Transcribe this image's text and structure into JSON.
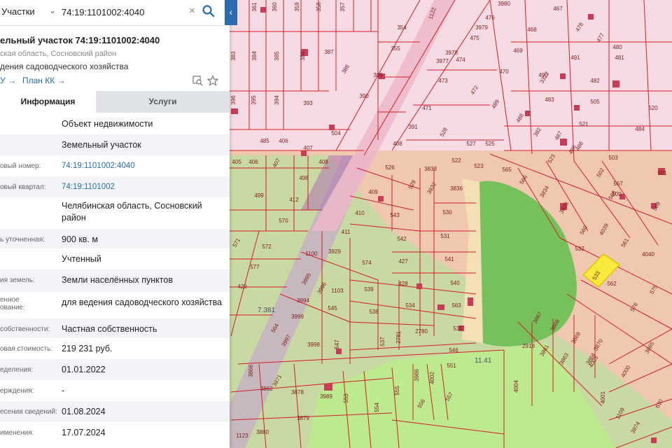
{
  "search": {
    "type_label": "Участки",
    "query": "74:19:1101002:4040"
  },
  "parcel": {
    "title": "ельный участок 74:19:1101002:4040",
    "address_short": "ская область, Сосновский район",
    "purpose_short": "дения садоводческого хозяйства",
    "link_egrn": "У →",
    "link_plan": "План КК →"
  },
  "tabs": {
    "info": "Информация",
    "services": "Услуги"
  },
  "info_rows": [
    {
      "label": "",
      "value": "Объект недвижимости"
    },
    {
      "label": "",
      "value": "Земельный участок"
    },
    {
      "label": "овый номер:",
      "value": "74:19:1101002:4040"
    },
    {
      "label": "овый квартал:",
      "value": "74:19:1101002"
    },
    {
      "label": "",
      "value": "Челябинская область, Сосновский район"
    },
    {
      "label": "ь уточненная:",
      "value": "900 кв. м"
    },
    {
      "label": "",
      "value": "Учтенный"
    },
    {
      "label": "ия земель:",
      "value": "Земли населённых пунктов"
    },
    {
      "label": "енное\nование:",
      "value": "для ведения садоводческого хозяйства"
    },
    {
      "label": "собственности:",
      "value": "Частная собственность"
    },
    {
      "label": "овая стоимость:",
      "value": "219 231 руб."
    },
    {
      "label": "еделения:",
      "value": "01.01.2022"
    },
    {
      "label": "ерждения:",
      "value": "-"
    },
    {
      "label": "есения сведений:",
      "value": "01.08.2024"
    },
    {
      "label": "именения:",
      "value": "17.07.2024"
    }
  ],
  "map": {
    "colors": {
      "boundary": "#d21f26",
      "pink_zone": "#f6dbe4",
      "orange_zone": "#f0c8b0",
      "green_zone": "#c9d9a3",
      "forest": "#77c15c",
      "meadow": "#bdea8f",
      "selected": "#f7ea3c"
    },
    "zone_labels": [
      "7.381",
      "11.41"
    ],
    "parcel_labels": [
      "361",
      "360",
      "359",
      "358",
      "357",
      "1122",
      "3980",
      "476",
      "467",
      "354",
      "3979",
      "468",
      "478",
      "477",
      "383",
      "384",
      "385",
      "386",
      "387",
      "355",
      "3978",
      "475",
      "469",
      "480",
      "3977",
      "474",
      "3322",
      "491",
      "481",
      "388",
      "389",
      "473",
      "470",
      "490",
      "482",
      "396",
      "395",
      "394",
      "393",
      "390",
      "472",
      "489",
      "483",
      "505",
      "520",
      "471",
      "488",
      "391",
      "528",
      "521",
      "484",
      "504",
      "392",
      "487",
      "486",
      "485",
      "406",
      "407",
      "408",
      "527",
      "525",
      "523",
      "486",
      "503",
      "405",
      "406",
      "407",
      "408",
      "526",
      "3833",
      "522",
      "523",
      "565",
      "566",
      "502",
      "501",
      "498",
      "409",
      "529",
      "3832",
      "3836",
      "3834",
      "567",
      "500",
      "499",
      "412",
      "410",
      "543",
      "530",
      "3835",
      "568",
      "569",
      "570",
      "411",
      "542",
      "531",
      "560",
      "4039",
      "571",
      "572",
      "3929",
      "427",
      "541",
      "532",
      "561",
      "4040",
      "577",
      "574",
      "428",
      "540",
      "533",
      "562",
      "575",
      "429",
      "3995",
      "3996",
      "539",
      "534",
      "563",
      "576",
      "3994",
      "545",
      "538",
      "3867",
      "3868",
      "3869",
      "3870",
      "3999",
      "537",
      "2781",
      "2780",
      "535",
      "564",
      "3997",
      "3998",
      "547",
      "546",
      "2918",
      "3861",
      "3863",
      "3864",
      "3865",
      "3866",
      "3871",
      "551",
      "3986",
      "4002",
      "4003",
      "4000",
      "3862",
      "3878",
      "3989",
      "553",
      "554",
      "555",
      "556",
      "557",
      "4004",
      "4001",
      "1109",
      "630",
      "3879",
      "3874",
      "1123",
      "3880",
      "1100",
      "1103"
    ]
  }
}
